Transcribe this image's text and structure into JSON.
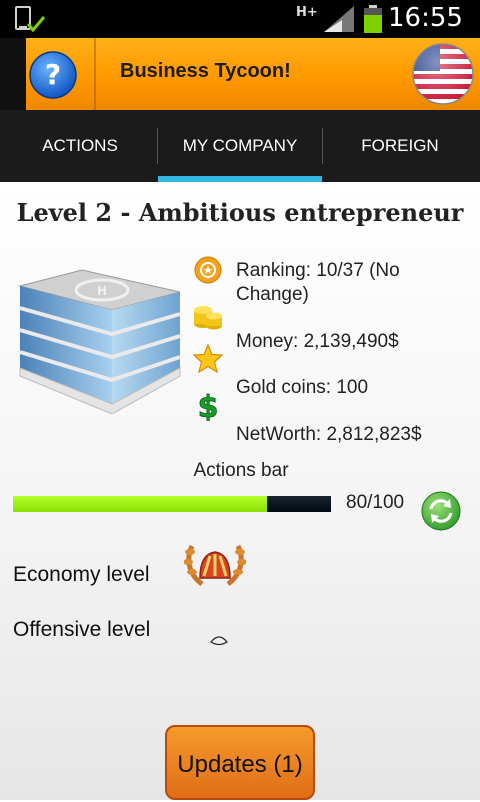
{
  "status_bar": {
    "network_type": "H+",
    "time": "16:55",
    "icons": [
      "device-check-icon",
      "signal-icon",
      "battery-icon"
    ],
    "battery_color": "#7fd000"
  },
  "header": {
    "title": "Business Tycoon!",
    "help_icon": "question-mark-icon",
    "flag_icon": "us-flag-icon",
    "brand_color": "#ff9a00"
  },
  "tabs": [
    {
      "label": "ACTIONS",
      "active": false
    },
    {
      "label": "MY COMPANY",
      "active": true
    },
    {
      "label": "FOREIGN",
      "active": false
    }
  ],
  "tab_indicator_color": "#33b5e5",
  "company": {
    "level_title": "Level 2 - Ambitious entrepreneur",
    "stats": {
      "ranking_line1": "Ranking: 10/37 (No",
      "ranking_line2": "Change)",
      "money": "Money: 2,139,490$",
      "gold": "Gold coins: 100",
      "networth": "NetWorth: 2,812,823$"
    },
    "stat_icons": [
      "medal-icon",
      "coins-icon",
      "star-icon",
      "dollar-icon"
    ]
  },
  "actions_bar": {
    "label": "Actions bar",
    "value_text": "80/100",
    "current": 80,
    "max": 100,
    "fill_color": "#9ef01a"
  },
  "levels": {
    "economy_label": "Economy level",
    "offensive_label": "Offensive level",
    "economy_icon": "laurel-shell-badge-icon",
    "offensive_icon": "small-badge-icon"
  },
  "updates_button": {
    "label": "Updates (1)",
    "color": "#e97a20"
  }
}
